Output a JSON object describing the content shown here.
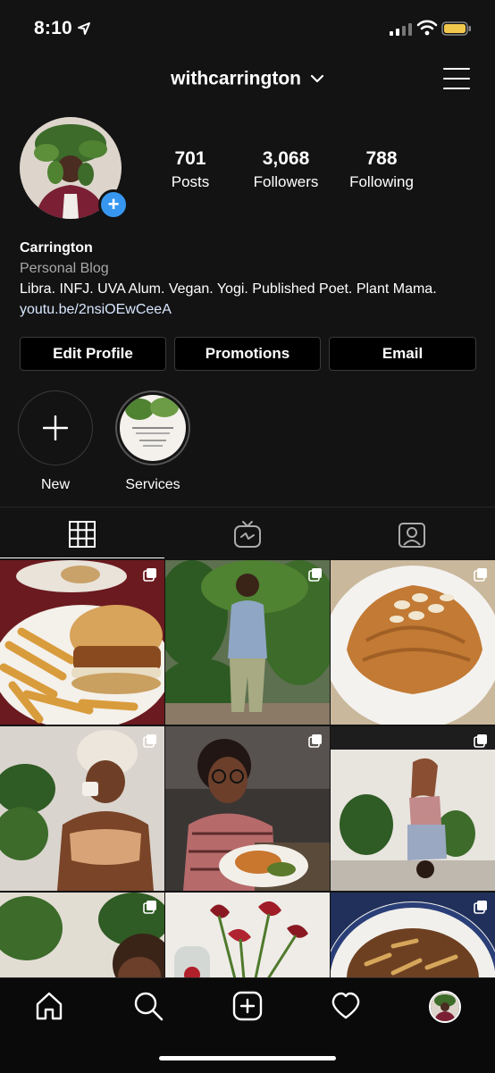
{
  "status_bar": {
    "time": "8:10"
  },
  "header": {
    "username": "withcarrington"
  },
  "profile": {
    "stats": [
      {
        "value": "701",
        "label": "Posts"
      },
      {
        "value": "3,068",
        "label": "Followers"
      },
      {
        "value": "788",
        "label": "Following"
      }
    ],
    "name": "Carrington",
    "category": "Personal Blog",
    "bio": "Libra. INFJ. UVA Alum. Vegan. Yogi. Published Poet. Plant Mama.",
    "link": "youtu.be/2nsiOEwCeeA"
  },
  "actions": {
    "edit_profile": "Edit Profile",
    "promotions": "Promotions",
    "email": "Email"
  },
  "highlights": [
    {
      "label": "New"
    },
    {
      "label": "Services"
    }
  ],
  "tabs": [
    "grid-icon",
    "igtv-icon",
    "tagged-icon"
  ],
  "posts": [
    {
      "subject": "burger-and-fries",
      "multi": true
    },
    {
      "subject": "plants-portrait",
      "multi": true
    },
    {
      "subject": "almond-croissant",
      "multi": true
    },
    {
      "subject": "towel-coffee",
      "multi": true
    },
    {
      "subject": "glasses-meal",
      "multi": true
    },
    {
      "subject": "yoga-headstand",
      "multi": true
    },
    {
      "subject": "monstera-selfie",
      "multi": true
    },
    {
      "subject": "red-flowers",
      "multi": true
    },
    {
      "subject": "pasta-plate",
      "multi": true
    }
  ],
  "bottom_nav": [
    "home-icon",
    "search-icon",
    "new-post-icon",
    "activity-icon",
    "profile-avatar"
  ],
  "colors": {
    "background": "#131313",
    "accent": "#3797f0",
    "link": "#d8e6ff"
  }
}
